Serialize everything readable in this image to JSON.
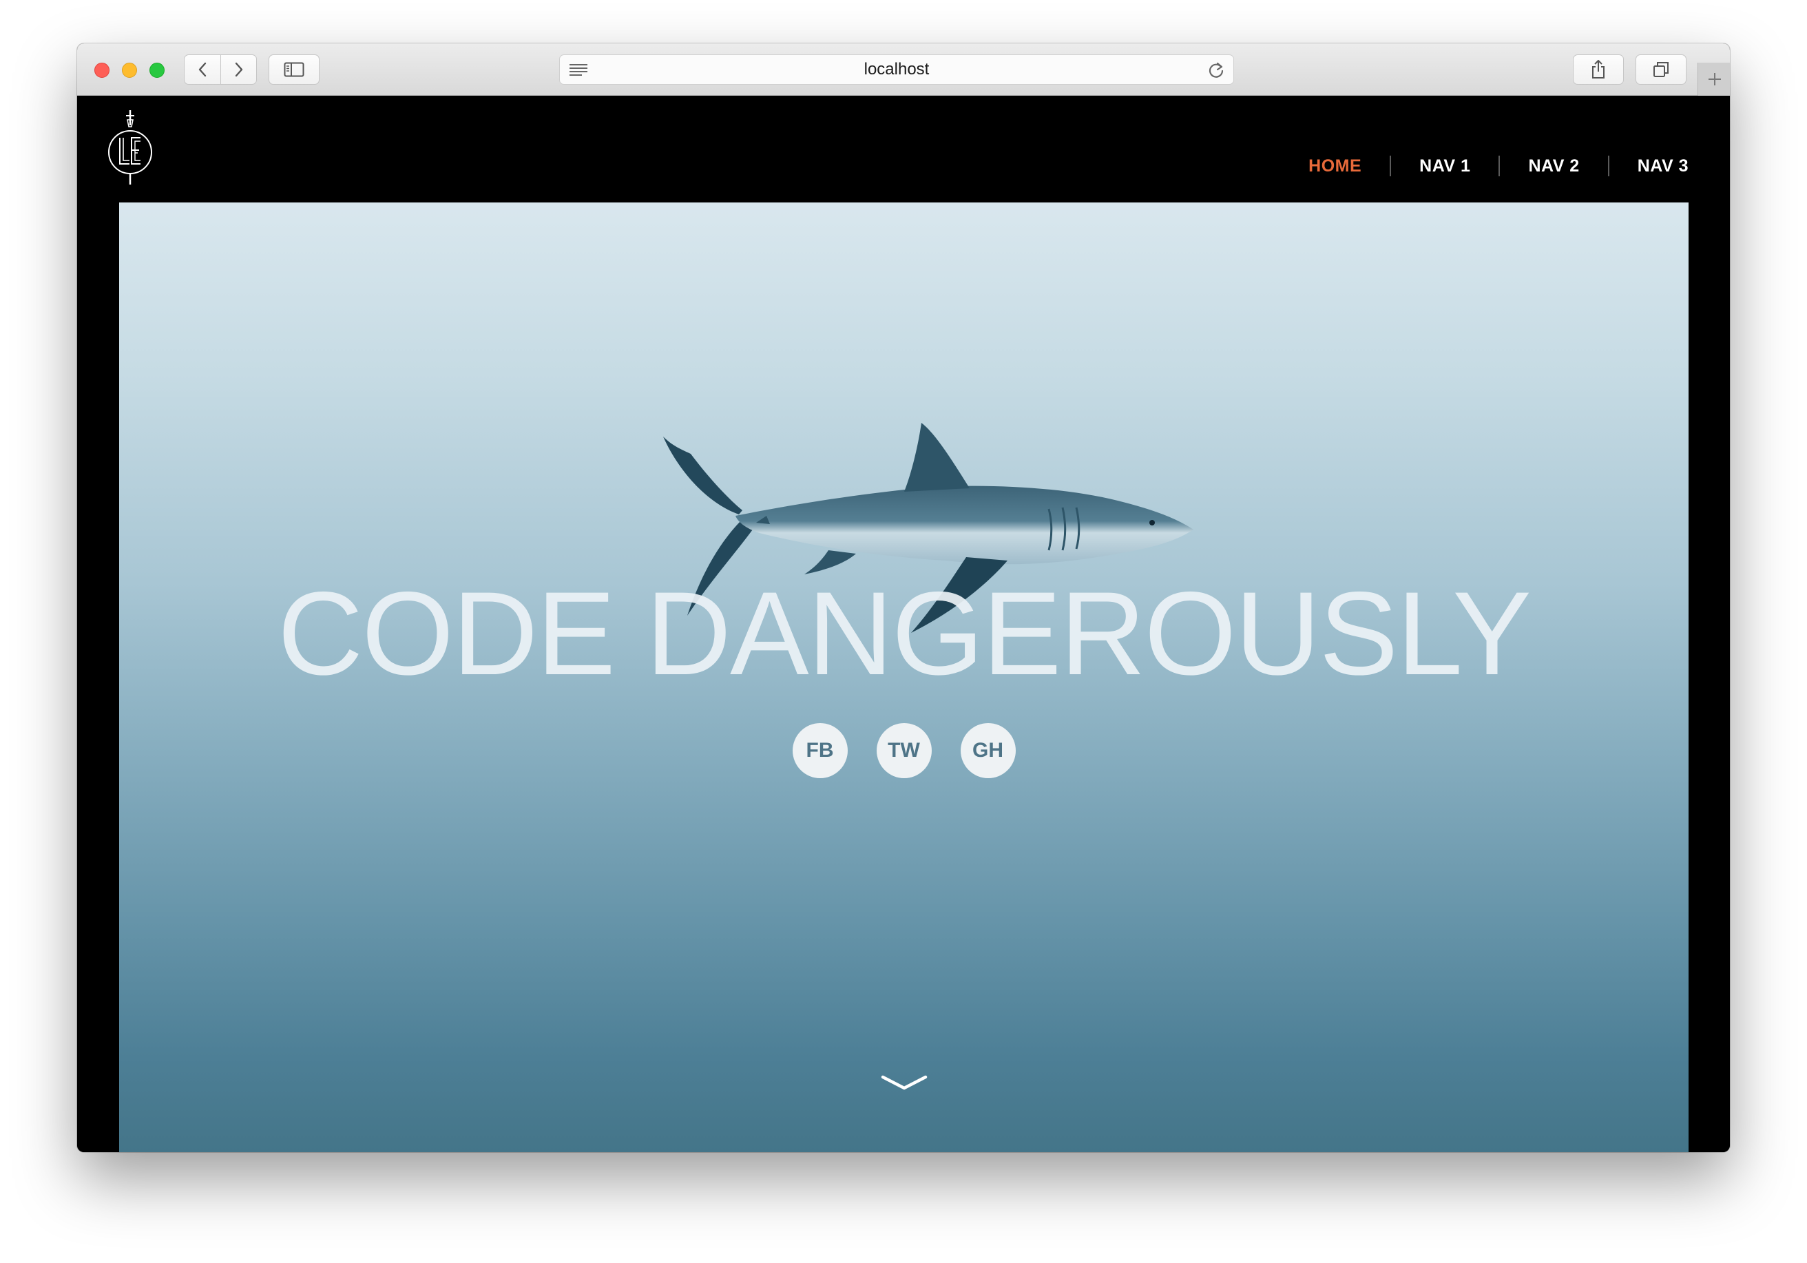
{
  "browser": {
    "url": "localhost"
  },
  "nav": {
    "items": [
      {
        "label": "HOME",
        "active": true
      },
      {
        "label": "NAV 1",
        "active": false
      },
      {
        "label": "NAV 2",
        "active": false
      },
      {
        "label": "NAV 3",
        "active": false
      }
    ],
    "active_color": "#e86a3a"
  },
  "hero": {
    "headline": "CODE DANGEROUSLY",
    "social": [
      {
        "label": "FB"
      },
      {
        "label": "TW"
      },
      {
        "label": "GH"
      }
    ]
  },
  "icons": [
    "back-icon",
    "forward-icon",
    "sidebar-icon",
    "reader-icon",
    "reload-icon",
    "share-icon",
    "tabs-icon",
    "plus-icon",
    "logo",
    "shark-image",
    "chevron-down-icon"
  ]
}
